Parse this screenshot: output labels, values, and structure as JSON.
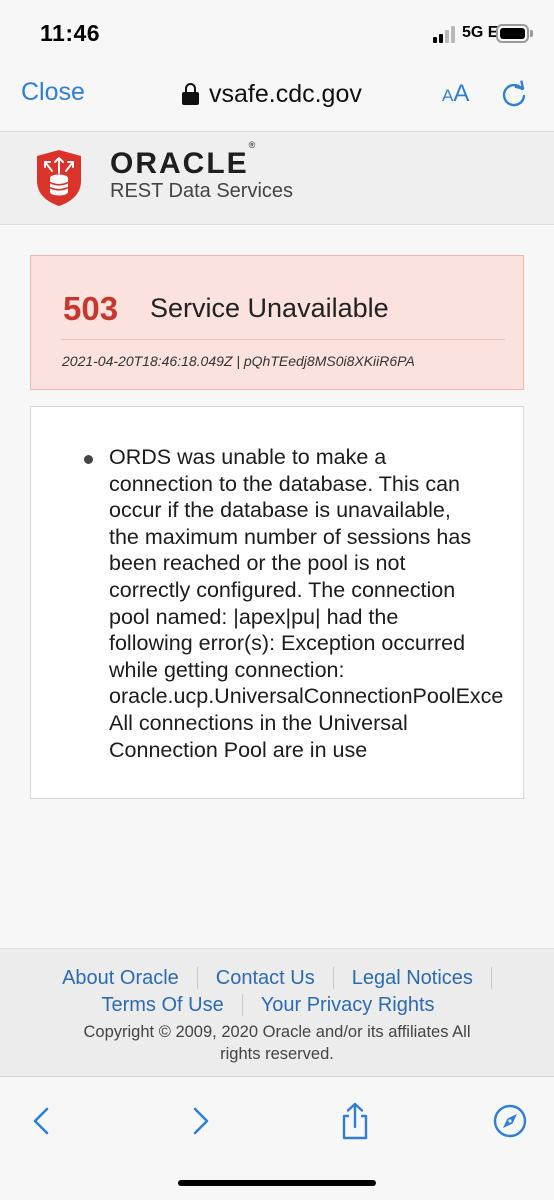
{
  "status_bar": {
    "time": "11:46",
    "network": "5G E",
    "signal_bars_active": 2,
    "signal_bars_total": 4
  },
  "browser": {
    "close_label": "Close",
    "url": "vsafe.cdc.gov",
    "aa_small": "A",
    "aa_big": "A",
    "accent_color": "#2f7fd4"
  },
  "header": {
    "brand": "ORACLE",
    "trademark": "®",
    "subtitle": "REST Data Services",
    "logo_icon": "ords-shield-database-icon"
  },
  "error": {
    "code": "503",
    "title": "Service Unavailable",
    "meta": "2021-04-20T18:46:18.049Z | pQhTEedj8MS0i8XKiiR6PA",
    "code_color": "#c8372d"
  },
  "message": {
    "lines": [
      "ORDS was unable to make a",
      "connection to the database. This can",
      "occur if the database is unavailable,",
      "the maximum number of sessions has",
      "been reached or the pool is not",
      "correctly configured. The connection",
      "pool named: |apex|pu| had the",
      "following error(s): Exception occurred",
      "while getting connection:",
      "oracle.ucp.UniversalConnectionPoolExce",
      "All connections in the Universal",
      "Connection Pool are in use"
    ]
  },
  "footer": {
    "links_row1": [
      "About Oracle",
      "Contact Us",
      "Legal Notices"
    ],
    "links_row2": [
      "Terms Of Use",
      "Your Privacy Rights"
    ],
    "copyright_line1": "Copyright © 2009, 2020 Oracle and/or its affiliates All",
    "copyright_line2": "rights reserved.",
    "link_color": "#2c6bb0"
  },
  "toolbar": {
    "icons": [
      "back-arrow-icon",
      "forward-arrow-icon",
      "share-icon",
      "compass-icon"
    ]
  }
}
